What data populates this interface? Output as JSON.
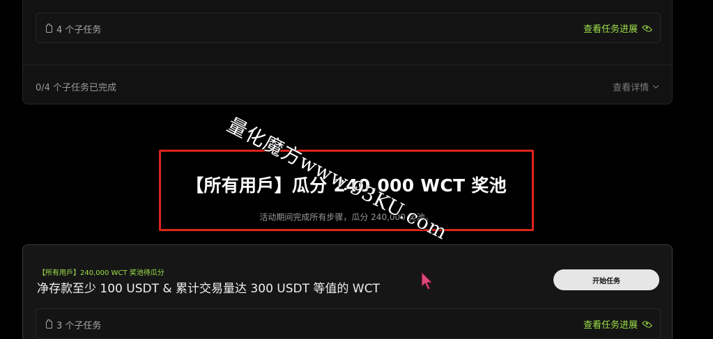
{
  "top_card": {
    "subtask_count": "4 个子任务",
    "view_progress": "查看任务进展",
    "progress_text": "0/4 个子任务已完成",
    "view_details": "查看详情"
  },
  "pool": {
    "title": "【所有用戶】瓜分 240,000 WCT 奖池",
    "subtitle": "活动期间完成所有步骤，瓜分 240,000 奖池。"
  },
  "watermark": {
    "text": "量化魔方www.93KU.com"
  },
  "bottom_card": {
    "tag": "【所有用戶】240,000 WCT 奖池待瓜分",
    "title": "净存款至少 100 USDT & 累计交易量达 300 USDT 等值的 WCT",
    "start_button": "开始任务",
    "subtask_count": "3 个子任务",
    "view_progress": "查看任务进展"
  },
  "colors": {
    "accent_green": "#9fe04a",
    "highlight_red": "#e0241c",
    "cursor_pink": "#e0487a"
  },
  "icons": [
    "clipboard-icon",
    "eye-icon",
    "chevron-down-icon",
    "mouse-cursor-icon"
  ]
}
